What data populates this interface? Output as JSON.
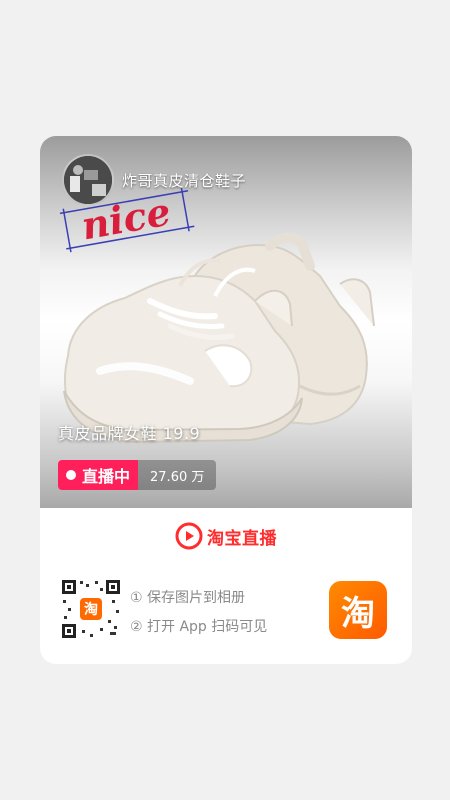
{
  "card": {
    "anchor_name": "炸哥真皮清仓鞋子",
    "sticker_text": "nice",
    "product_title": "真皮品牌女鞋 19.9",
    "live_badge": "直播中",
    "viewer_count": "27.60 万",
    "brand_label": "淘宝直播",
    "steps": [
      "① 保存图片到相册",
      "② 打开 App 扫码可见"
    ],
    "app_icon_glyph": "淘",
    "qr_center_glyph": "淘",
    "colors": {
      "live_badge": "#ff1f5a",
      "brand_red": "#ff2d2d",
      "taobao_orange": "#ff6a00",
      "sticker_red": "#d81e3c"
    },
    "icons": [
      "avatar",
      "live-dot",
      "taobao-live-logo-icon",
      "qr-code",
      "taobao-app-icon"
    ]
  }
}
